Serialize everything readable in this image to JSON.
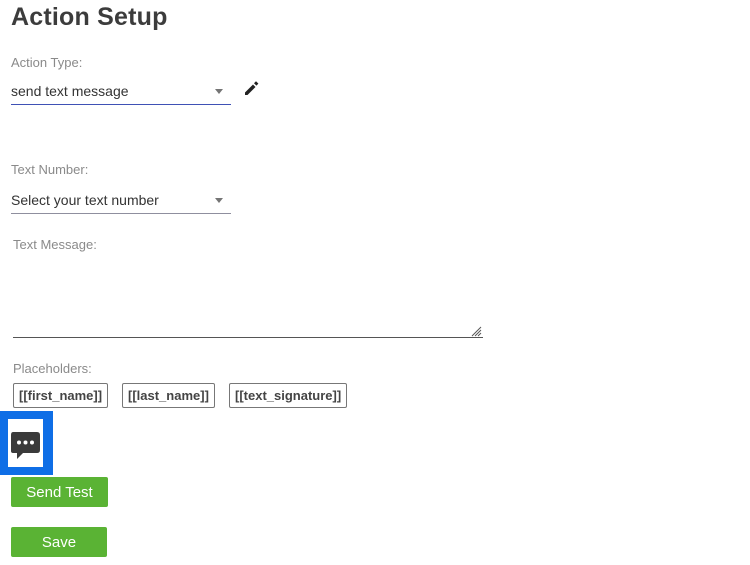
{
  "page": {
    "title": "Action Setup"
  },
  "action_type": {
    "label": "Action Type:",
    "value": "send text message",
    "edit_icon": "pencil-icon"
  },
  "text_number": {
    "label": "Text Number:",
    "value": "Select your text number"
  },
  "text_message": {
    "label": "Text Message:",
    "value": ""
  },
  "placeholders": {
    "label": "Placeholders:",
    "items": [
      "[[first_name]]",
      "[[last_name]]",
      "[[text_signature]]"
    ]
  },
  "chat": {
    "icon": "chat-bubble-icon",
    "highlight_color": "#0e6ee6"
  },
  "buttons": {
    "send_test": "Send Test",
    "save": "Save",
    "color": "#5ab334"
  }
}
